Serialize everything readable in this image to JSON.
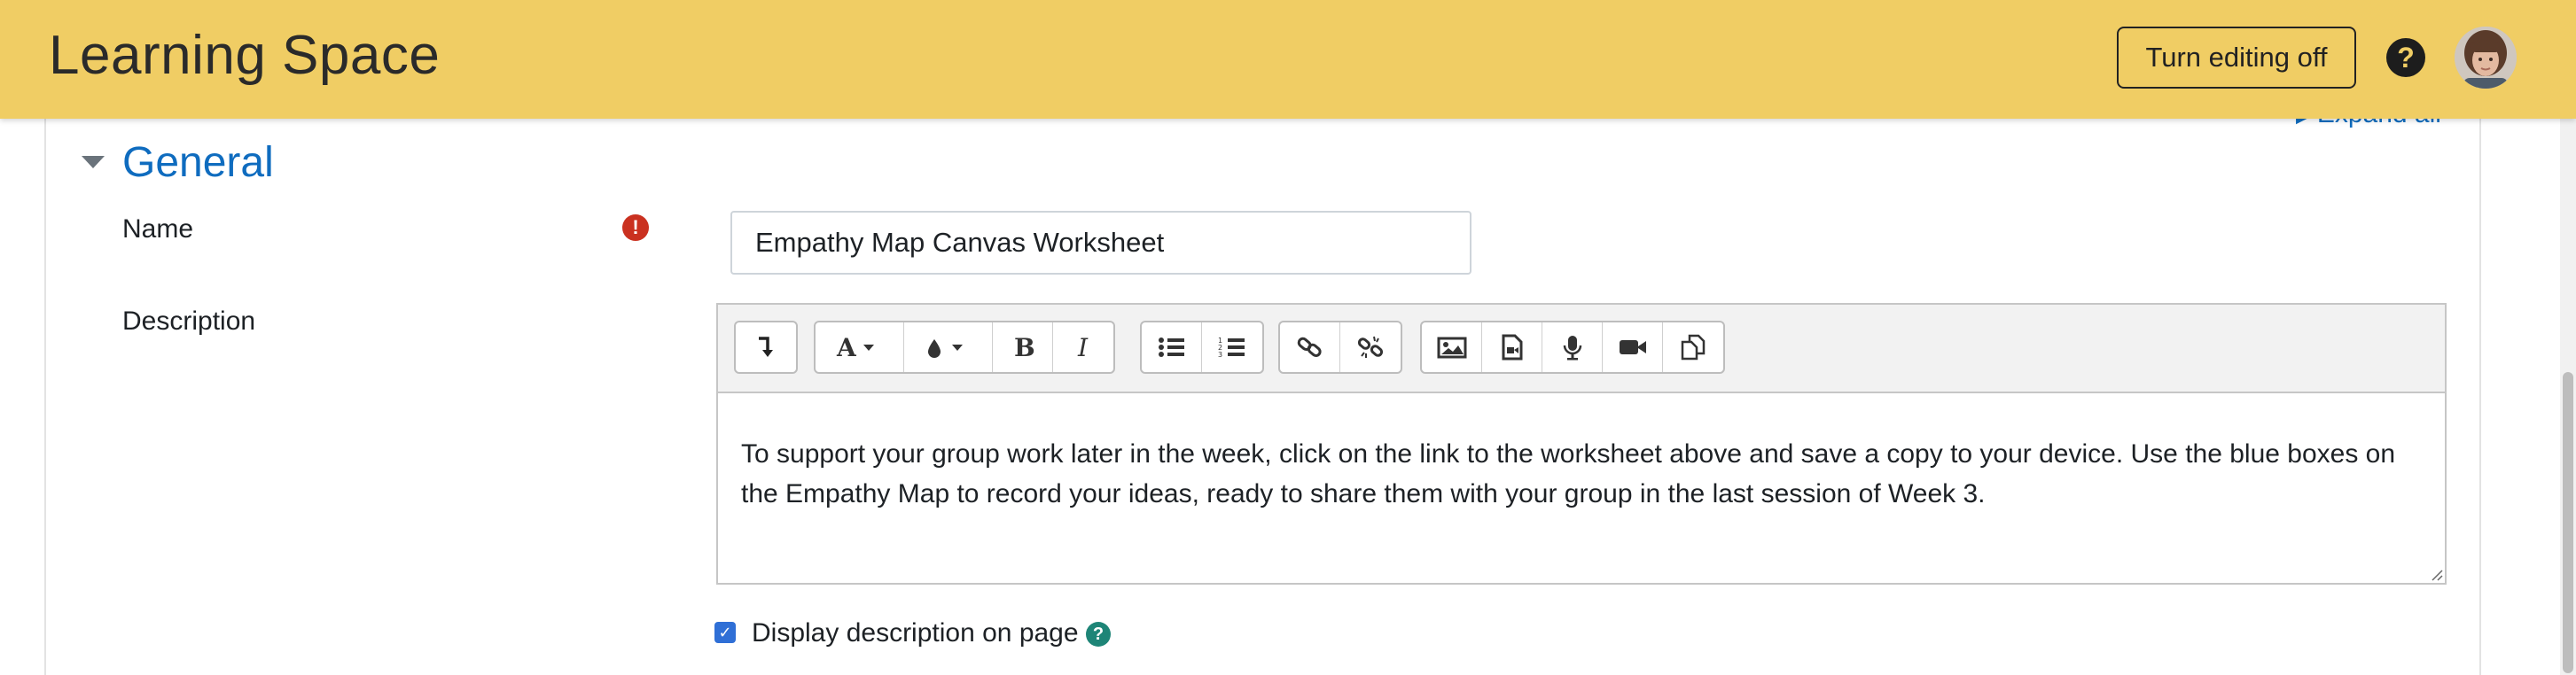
{
  "header": {
    "site_title": "Learning Space",
    "editing_button_label": "Turn editing off",
    "help_icon_glyph": "?",
    "avatar_icon": "user-avatar-photo",
    "background_color": "#f0cd64"
  },
  "page": {
    "expand_all_label": "Expand all"
  },
  "section": {
    "title": "General",
    "toggle_icon": "caret-down-icon"
  },
  "fields": {
    "name": {
      "label": "Name",
      "required_icon_glyph": "!",
      "value": "Empathy Map Canvas Worksheet"
    },
    "description": {
      "label": "Description",
      "toolbar": [
        [
          "toggle-toolbar-icon"
        ],
        [
          "font-style-icon",
          "font-color-icon",
          "bold-icon",
          "italic-icon"
        ],
        [
          "unordered-list-icon",
          "ordered-list-icon"
        ],
        [
          "link-icon",
          "unlink-icon"
        ],
        [
          "image-icon",
          "media-icon",
          "record-audio-icon",
          "record-video-icon",
          "manage-files-icon"
        ]
      ],
      "content": "To support your group work later in the week, click on the link to the worksheet above and save a copy to your device. Use the blue boxes on the Empathy Map to record your ideas, ready to share them with your group in the last session of Week 3."
    },
    "display_description": {
      "label": "Display description on page",
      "checked": true,
      "help_icon_glyph": "?"
    }
  },
  "colors": {
    "link": "#0f6cbf",
    "required": "#ca3120",
    "help": "#1e8577",
    "checkbox": "#2f6fd6"
  }
}
